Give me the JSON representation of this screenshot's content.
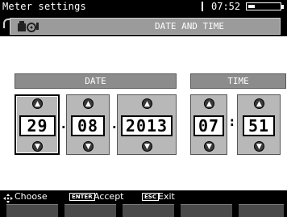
{
  "title_bar": {
    "title": "Meter settings",
    "clock": "07:52"
  },
  "header": {
    "icon": "settings-tools-icon",
    "title": "DATE AND TIME"
  },
  "date": {
    "label": "DATE",
    "day": "29",
    "month": "08",
    "year": "2013",
    "separator": "."
  },
  "time": {
    "label": "TIME",
    "hour": "07",
    "minute": "51",
    "separator": ":"
  },
  "footer": {
    "choose_label": "Choose",
    "enter_key": "ENTER",
    "accept_label": "Accept",
    "esc_key": "ESC",
    "exit_label": "Exit"
  },
  "colors": {
    "background": "#ffffff",
    "bar": "#000000",
    "panel": "#b8b8b8",
    "section_head": "#8c8c8c"
  }
}
